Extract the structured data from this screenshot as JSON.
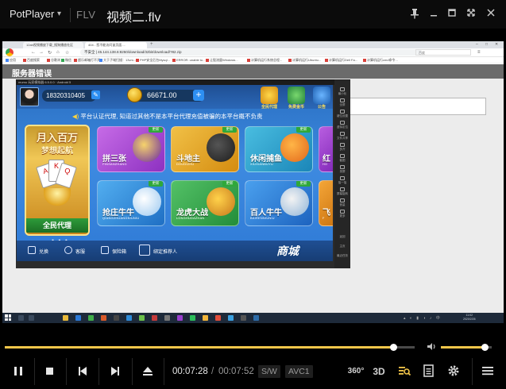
{
  "player": {
    "app_name": "PotPlayer",
    "format": "FLV",
    "file_name": "视频二.flv",
    "time_current": "00:07:28",
    "time_separator": "/",
    "time_total": "00:07:52",
    "progress_fraction": 0.949,
    "volume_fraction": 0.86,
    "tag_sw": "S/W",
    "tag_codec": "AVC1",
    "btn_360": "360°",
    "btn_3d": "3D",
    "accent_color": "#f3c64a"
  },
  "browser": {
    "tabs": [
      "12ah视频播放下载_搜狗播放社区",
      "404 - 您不能访问该页面...."
    ],
    "url": "不安全 | 45.144.138.6:8250/download/32bit/download/?82.zip",
    "search_placeholder": "百度",
    "bookmarks": [
      "应用",
      "百度搜索",
      "谷歌浏",
      "微信",
      "超乐邮箱打不开...",
      "大于子域扫描：13vm...",
      "PHP安全后台Mysql...",
      "ERROR: unable to...",
      "让股流量Windows...",
      "计算机运行系统总程...",
      "计算机运行Ubuntu...",
      "计算机运行Dell Fa...",
      "计算机运行cmd命令..."
    ],
    "page_title": "服务器错误"
  },
  "emulator": {
    "title": "mumu 玩家模拟器 6.5.0.0 · Android 5",
    "side_items": [
      "最小化",
      "全屏",
      "键位设置",
      "虚拟定位",
      "文件共享",
      "多开",
      "截图",
      "录屏",
      "摇一摇",
      "屏幕旋转",
      "音量",
      "更多",
      "返回",
      "主页",
      "最近任务"
    ]
  },
  "game": {
    "user_id": "18320310405",
    "coins": "66671.00",
    "top_icons": [
      "全民代理",
      "免费金币",
      "公告"
    ],
    "notice": "平台认证代理, 知道过其他不是本平台代理充值被骗的本平台概不负责",
    "banner": {
      "line1": "月入百万",
      "line2": "梦想起航",
      "line3": "全民代理"
    },
    "new_badge": "更新",
    "games": [
      {
        "name": "拼三张",
        "pinyin": "PINSANZHANG",
        "color": "#b34fd9"
      },
      {
        "name": "斗地主",
        "pinyin": "DOUDIZHU",
        "color": "#e2a21a"
      },
      {
        "name": "休闲捕鱼",
        "pinyin": "XIUXIANBUYU",
        "color": "#2fa2c8"
      },
      {
        "name": "红",
        "pinyin": "HO",
        "color": "#a73fd0"
      },
      {
        "name": "抢庄牛牛",
        "pinyin": "QIANGZHUANGNIUNIU",
        "color": "#2d94d8"
      },
      {
        "name": "龙虎大战",
        "pinyin": "LONGHUDAZHAN",
        "color": "#33a94a"
      },
      {
        "name": "百人牛牛",
        "pinyin": "BAIRENNIUNIU",
        "color": "#2f86d8"
      },
      {
        "name": "飞",
        "pinyin": "F",
        "color": "#e08a1c"
      }
    ],
    "bottom": {
      "exchange": "兑换",
      "service": "客服",
      "safe": "保险箱",
      "bind": "绑定推荐人",
      "shop": "商城"
    }
  },
  "taskbar": {
    "time": "11:02",
    "date": "2020/2/26"
  }
}
